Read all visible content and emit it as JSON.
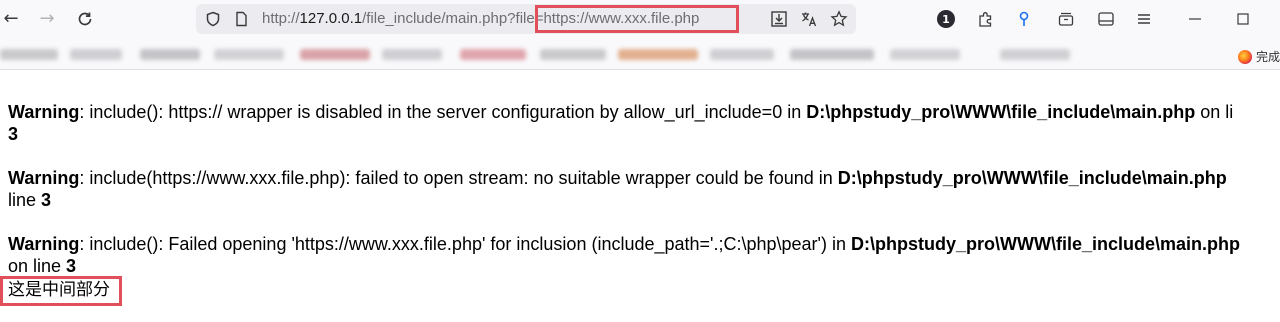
{
  "browser": {
    "back_icon": "arrow-left-icon",
    "forward_icon": "arrow-right-icon",
    "reload_icon": "reload-icon",
    "url": {
      "prefix": "http://",
      "host": "127.0.0.1",
      "path": "/file_include/main.php?",
      "query": "file=https://www.xxx.file.php"
    },
    "notification_count": "1",
    "bookmarks_trailing": "完成"
  },
  "page": {
    "warnings": [
      {
        "label": "Warning",
        "text": ": include(): https:// wrapper is disabled in the server configuration by allow_url_include=0 in ",
        "file": "D:\\phpstudy_pro\\WWW\\file_include\\main.php",
        "suffix": " on li",
        "line_prefix": "",
        "line": "3"
      },
      {
        "label": "Warning",
        "text": ": include(https://www.xxx.file.php): failed to open stream: no suitable wrapper could be found in ",
        "file": "D:\\phpstudy_pro\\WWW\\file_include\\main.php",
        "suffix": "",
        "line_prefix": "line ",
        "line": "3"
      },
      {
        "label": "Warning",
        "text": ": include(): Failed opening 'https://www.xxx.file.php' for inclusion (include_path='.;C:\\php\\pear') in ",
        "file": "D:\\phpstudy_pro\\WWW\\file_include\\main.php",
        "suffix": "",
        "line_prefix": "on line ",
        "line": "3"
      }
    ],
    "middle_text": "这是中间部分"
  },
  "colors": {
    "highlight": "#e04f5a",
    "toolbar_bg": "#f9f9fb",
    "urlbar_bg": "#ececf0"
  }
}
